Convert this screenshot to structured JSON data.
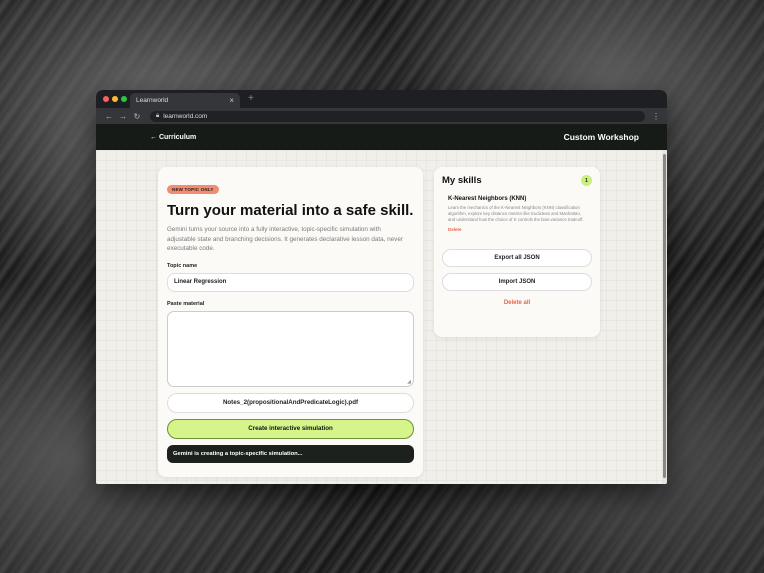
{
  "browser": {
    "tab_title": "Learnworld",
    "tab_close": "×",
    "new_tab": "+",
    "url": "learnworld.com"
  },
  "header": {
    "back_label": "← Curriculum",
    "title": "Custom Workshop"
  },
  "form": {
    "badge": "NEW TOPIC ONLY",
    "headline": "Turn your material into a safe skill.",
    "description": "Gemini turns your source into a fully interactive, topic-specific simulation with adjustable state and branching decisions. It generates declarative lesson data, never executable code.",
    "topic_label": "Topic name",
    "topic_value": "Linear Regression",
    "material_label": "Paste material",
    "material_value": "",
    "file_name": "Notes_2(propositionalAndPredicateLogic).pdf",
    "create_label": "Create interactive simulation",
    "status_text": "Gemini is creating a topic-specific simulation..."
  },
  "skills": {
    "title": "My skills",
    "count": "1",
    "items": [
      {
        "name": "K-Nearest Neighbors (KNN)",
        "description": "Learn the mechanics of the K-Nearest Neighbors (KNN) classification algorithm, explore key distance metrics like Euclidean and Manhattan, and understand how the choice of K controls the bias-variance tradeoff.",
        "delete_label": "Delete"
      }
    ],
    "export_label": "Export all JSON",
    "import_label": "Import JSON",
    "delete_all_label": "Delete all"
  }
}
